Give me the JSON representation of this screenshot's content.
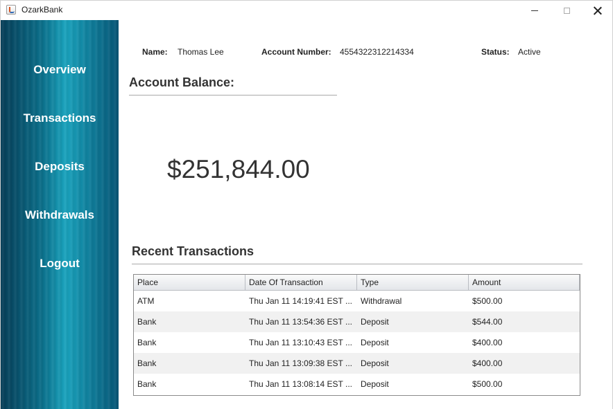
{
  "window": {
    "title": "OzarkBank",
    "icon": "java-cup-icon"
  },
  "sidebar": {
    "items": [
      {
        "label": "Overview"
      },
      {
        "label": "Transactions"
      },
      {
        "label": "Deposits"
      },
      {
        "label": "Withdrawals"
      },
      {
        "label": "Logout"
      }
    ]
  },
  "account": {
    "name_label": "Name:",
    "name": "Thomas Lee",
    "number_label": "Account Number:",
    "number": "4554322312214334",
    "status_label": "Status:",
    "status": "Active"
  },
  "balance": {
    "title": "Account Balance:",
    "amount": "$251,844.00"
  },
  "transactions": {
    "title": "Recent Transactions",
    "columns": [
      "Place",
      "Date Of Transaction",
      "Type",
      "Amount"
    ],
    "rows": [
      {
        "place": "ATM",
        "date": "Thu Jan 11 14:19:41 EST ...",
        "type": "Withdrawal",
        "amount": "$500.00"
      },
      {
        "place": "Bank",
        "date": "Thu Jan 11 13:54:36 EST ...",
        "type": "Deposit",
        "amount": "$544.00"
      },
      {
        "place": "Bank",
        "date": "Thu Jan 11 13:10:43 EST ...",
        "type": "Deposit",
        "amount": "$400.00"
      },
      {
        "place": "Bank",
        "date": "Thu Jan 11 13:09:38 EST ...",
        "type": "Deposit",
        "amount": "$400.00"
      },
      {
        "place": "Bank",
        "date": "Thu Jan 11 13:08:14 EST ...",
        "type": "Deposit",
        "amount": "$500.00"
      }
    ]
  },
  "colors": {
    "sidebar_dark": "#063d57",
    "sidebar_light": "#1aa3bd",
    "text": "#222222"
  }
}
